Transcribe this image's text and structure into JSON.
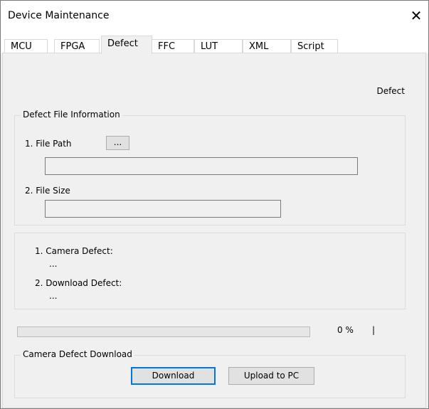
{
  "window": {
    "title": "Device Maintenance",
    "close_glyph": "✕"
  },
  "tabs": [
    {
      "label": "MCU"
    },
    {
      "label": "FPGA"
    },
    {
      "label": "Defect",
      "active": true
    },
    {
      "label": "FFC"
    },
    {
      "label": "LUT"
    },
    {
      "label": "XML"
    },
    {
      "label": "Script"
    }
  ],
  "panel": {
    "heading": "Defect",
    "file_info": {
      "title": "Defect File Information",
      "file_path_label": "1. File Path",
      "browse_label": "...",
      "file_path_value": "",
      "file_size_label": "2. File Size",
      "file_size_value": ""
    },
    "status": {
      "camera_defect_label": "1. Camera Defect:",
      "camera_defect_value": "...",
      "download_defect_label": "2. Download Defect:",
      "download_defect_value": "..."
    },
    "progress": {
      "percent": 0,
      "text": "0 %",
      "indicator": "|"
    },
    "download": {
      "title": "Camera Defect Download",
      "download_label": "Download",
      "upload_label": "Upload to PC"
    }
  },
  "colors": {
    "accent": "#0078d7",
    "progress_fill": "#06b025"
  }
}
